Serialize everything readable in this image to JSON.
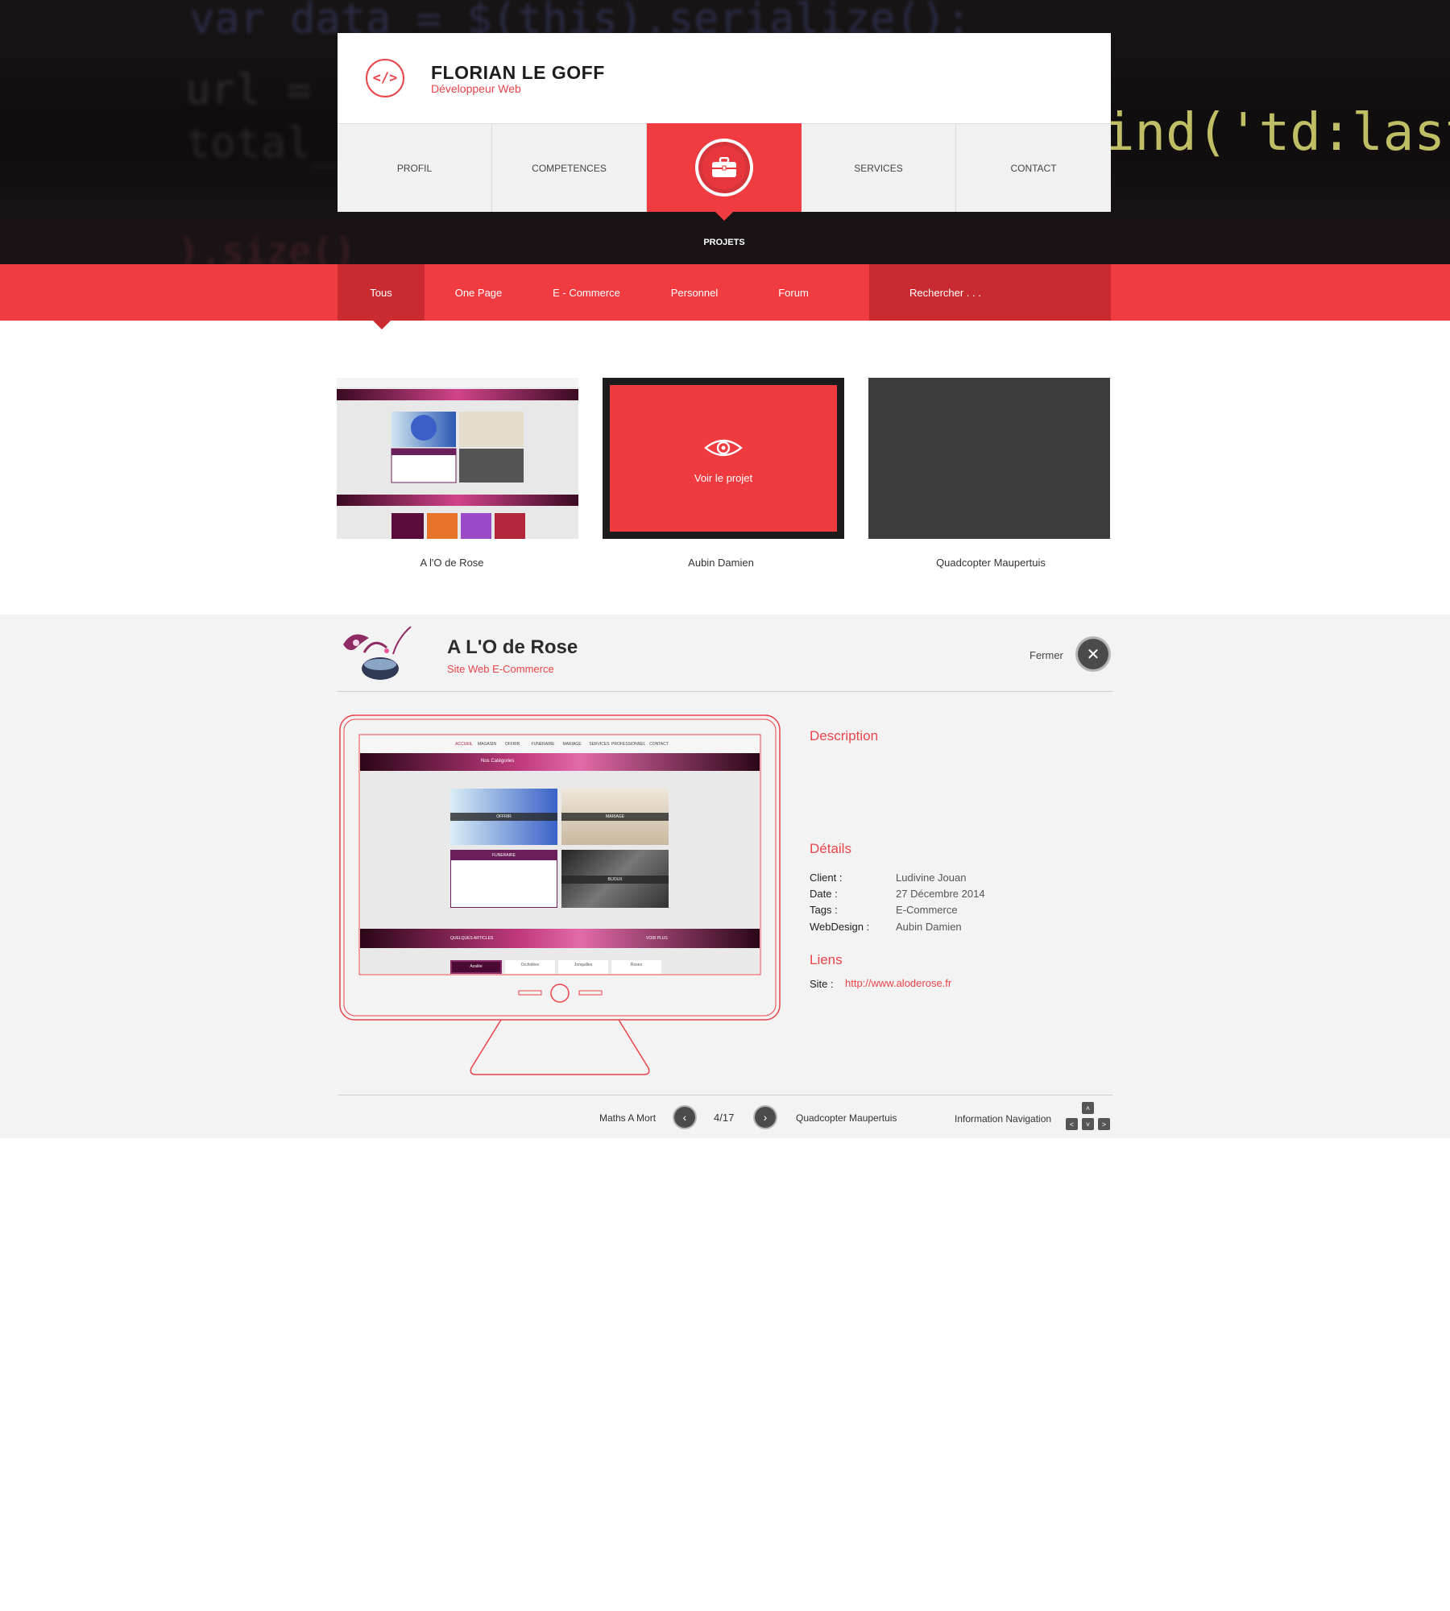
{
  "hero": {
    "code_line1": "var data = $(this).serialize();",
    "code_line2": "url = $",
    "code_line3": "total_f",
    "code_line4": "ind('td:last",
    "code_line5": ").size()"
  },
  "header": {
    "name": "FLORIAN LE GOFF",
    "subtitle": "Développeur Web",
    "logo_icon": "code-icon",
    "logo_glyph": "</>"
  },
  "nav": {
    "items": [
      {
        "label": "PROFIL"
      },
      {
        "label": "COMPETENCES"
      },
      {
        "label": "PROJETS",
        "icon": "briefcase-icon"
      },
      {
        "label": "SERVICES"
      },
      {
        "label": "CONTACT"
      }
    ],
    "active_label": "PROJETS"
  },
  "filters": {
    "items": [
      "Tous",
      "One Page",
      "E - Commerce",
      "Personnel",
      "Forum"
    ],
    "search_placeholder": "Rechercher . . ."
  },
  "projects": [
    {
      "title": "A l'O de Rose"
    },
    {
      "title": "Aubin Damien",
      "hover_label": "Voir le projet"
    },
    {
      "title": "Quadcopter Maupertuis"
    }
  ],
  "detail": {
    "title": "A L'O de Rose",
    "subtitle": "Site Web E-Commerce",
    "close_label": "Fermer",
    "description_heading": "Description",
    "details_heading": "Détails",
    "details": [
      {
        "key": "Client :",
        "value": "Ludivine Jouan"
      },
      {
        "key": "Date :",
        "value": "27 Décembre 2014"
      },
      {
        "key": "Tags :",
        "value": "E-Commerce"
      },
      {
        "key": "WebDesign :",
        "value": "Aubin Damien"
      }
    ],
    "links_heading": "Liens",
    "site_key": "Site :",
    "site_url": "http://www.aloderose.fr"
  },
  "mock_site": {
    "nav": [
      "ACCUEIL",
      "MAGASIN",
      "OFFRIR",
      "FUNERAIRE",
      "MARIAGE",
      "SERVICES",
      "PROFESSIONNEL",
      "CONTACT"
    ],
    "banner": "Nos Catégories",
    "tiles": [
      "OFFRIR",
      "MARIAGE",
      "FUNERAIRE",
      "BIJOUX"
    ],
    "articles": "QUELQUES ARTICLES",
    "more": "VOIR PLUS",
    "tabs": [
      "Azalée",
      "Orchidées",
      "Jonquilles",
      "Roses"
    ]
  },
  "pager": {
    "prev_label": "Maths A Mort",
    "counter": "4/17",
    "next_label": "Quadcopter Maupertuis",
    "info_label": "Information Navigation"
  },
  "colors": {
    "accent": "#f03c40",
    "accent_dark": "#c92b30"
  }
}
